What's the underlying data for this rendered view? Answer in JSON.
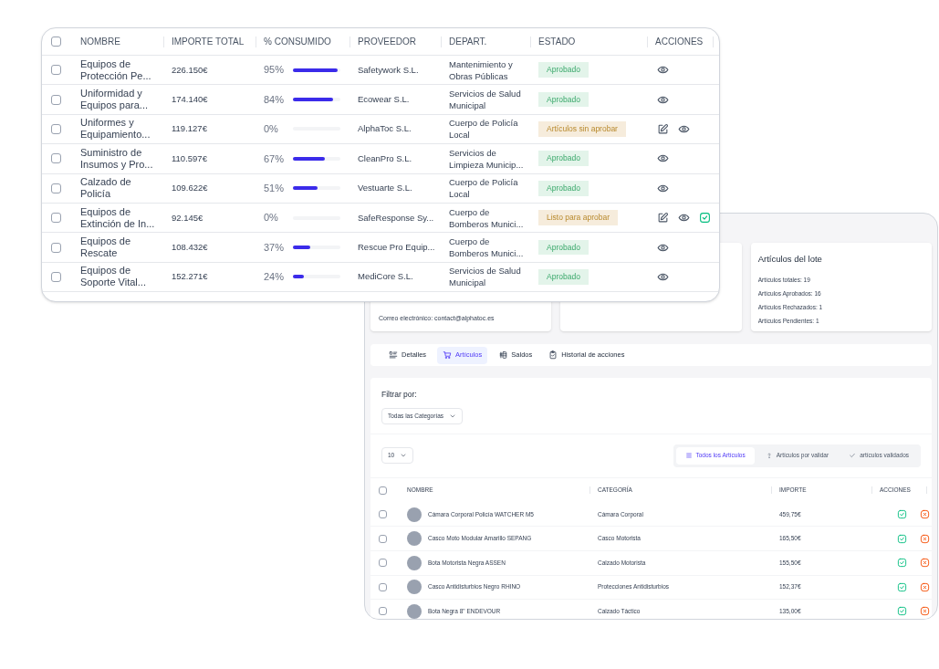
{
  "budget_table": {
    "all_checked": false,
    "columns": [
      "NOMBRE",
      "IMPORTE TOTAL",
      "% CONSUMIDO",
      "PROVEEDOR",
      "DEPART.",
      "ESTADO",
      "ACCIONES"
    ],
    "rows": [
      {
        "checked": false,
        "name": "Equipos de Protección Pe...",
        "amount": "226.150€",
        "consumed": "95%",
        "level": 0.95,
        "supplier": "Safetywork S.L.",
        "department": "Mantenimiento y Obras Públicas",
        "status": {
          "kind": "approved",
          "label": "Aprobado"
        },
        "actions": [
          {
            "kind": "view"
          }
        ]
      },
      {
        "checked": false,
        "name": "Uniformidad y Equipos para...",
        "amount": "174.140€",
        "consumed": "84%",
        "level": 0.84,
        "supplier": "Ecowear S.L.",
        "department": "Servicios de Salud Municipal",
        "status": {
          "kind": "approved",
          "label": "Aprobado"
        },
        "actions": [
          {
            "kind": "view"
          }
        ]
      },
      {
        "checked": false,
        "name": "Uniformes y Equipamiento...",
        "amount": "119.127€",
        "consumed": "0%",
        "level": 0,
        "supplier": "AlphaToc S.L.",
        "department": "Cuerpo de Policía Local",
        "status": {
          "kind": "pending",
          "label": "Artículos sin aprobar"
        },
        "actions": [
          {
            "kind": "edit"
          },
          {
            "kind": "view"
          }
        ]
      },
      {
        "checked": false,
        "name": "Suministro de Insumos y Pro...",
        "amount": "110.597€",
        "consumed": "67%",
        "level": 0.67,
        "supplier": "CleanPro S.L.",
        "department": "Servicios de Limpieza Municip...",
        "status": {
          "kind": "approved",
          "label": "Aprobado"
        },
        "actions": [
          {
            "kind": "view"
          }
        ]
      },
      {
        "checked": false,
        "name": "Calzado de Policía",
        "amount": "109.622€",
        "consumed": "51%",
        "level": 0.51,
        "supplier": "Vestuarte S.L.",
        "department": "Cuerpo de Policía Local",
        "status": {
          "kind": "approved",
          "label": "Aprobado"
        },
        "actions": [
          {
            "kind": "view"
          }
        ]
      },
      {
        "checked": false,
        "name": "Equipos de Extinción de In...",
        "amount": "92.145€",
        "consumed": "0%",
        "level": 0,
        "supplier": "SafeResponse Sy...",
        "department": "Cuerpo de Bomberos Munici...",
        "status": {
          "kind": "pending",
          "label": "Listo para aprobar"
        },
        "actions": [
          {
            "kind": "edit"
          },
          {
            "kind": "view"
          },
          {
            "kind": "approve"
          }
        ]
      },
      {
        "checked": false,
        "name": "Equipos de Rescate",
        "amount": "108.432€",
        "consumed": "37%",
        "level": 0.37,
        "supplier": "Rescue Pro Equip...",
        "department": "Cuerpo de Bomberos Munici...",
        "status": {
          "kind": "approved",
          "label": "Aprobado"
        },
        "actions": [
          {
            "kind": "view"
          }
        ]
      },
      {
        "checked": false,
        "name": "Equipos de Soporte Vital...",
        "amount": "152.271€",
        "consumed": "24%",
        "level": 0.24,
        "supplier": "MediCore S.L.",
        "department": "Servicios de Salud Municipal",
        "status": {
          "kind": "approved",
          "label": "Aprobado"
        },
        "actions": [
          {
            "kind": "view"
          }
        ]
      }
    ]
  },
  "lot_detail": {
    "contact_card": {
      "lines": [
        "Correo electrónico: contact@alphatoc.es"
      ]
    },
    "lot_card": {
      "title": "Artículos del lote",
      "lines": [
        "Artículos totales: 19",
        "Artículos Aprobados: 16",
        "Artículos Rechazados: 1",
        "Artículos Pendientes: 1"
      ]
    },
    "tabs": [
      {
        "label": "Detalles",
        "kind": "details",
        "selected": false
      },
      {
        "label": "Artículos",
        "kind": "cart",
        "selected": true
      },
      {
        "label": "Saldos",
        "kind": "coins",
        "selected": false
      },
      {
        "label": "Historial de acciones",
        "kind": "clipboard",
        "selected": false
      }
    ],
    "filter": {
      "label": "Filtrar por:",
      "category": "Todas las Categorías"
    },
    "page_size": "10",
    "view_filters": [
      {
        "label": "Todos los Artículos",
        "kind": "list",
        "selected": true
      },
      {
        "label": "Artículos por validar",
        "kind": "question",
        "selected": false
      },
      {
        "label": "artículos validados",
        "kind": "check",
        "selected": false
      }
    ],
    "articles": {
      "all_checked": false,
      "columns": [
        "NOMBRE",
        "CATEGORÍA",
        "IMPORTE",
        "ACCIONES"
      ],
      "rows": [
        {
          "checked": false,
          "name": "Cámara Corporal Policía WATCHER M5",
          "category": "Cámara Corporal",
          "amount": "459,75€",
          "actions": [
            {
              "kind": "approve"
            },
            {
              "kind": "reject"
            }
          ]
        },
        {
          "checked": false,
          "name": "Casco Moto Modular Amarillo SEPANG",
          "category": "Casco Motorista",
          "amount": "165,50€",
          "actions": [
            {
              "kind": "approve"
            },
            {
              "kind": "reject"
            }
          ]
        },
        {
          "checked": false,
          "name": "Bota Motorista Negra ASSEN",
          "category": "Calzado Motorista",
          "amount": "155,50€",
          "actions": [
            {
              "kind": "approve"
            },
            {
              "kind": "reject"
            }
          ]
        },
        {
          "checked": false,
          "name": "Casco Antidisturbios Negro RHINO",
          "category": "Protecciones Antidisturbios",
          "amount": "152,37€",
          "actions": [
            {
              "kind": "approve"
            },
            {
              "kind": "reject"
            }
          ]
        },
        {
          "checked": false,
          "name": "Bota Negra 8\" ENDEVOUR",
          "category": "Calzado Táctico",
          "amount": "135,00€",
          "actions": [
            {
              "kind": "approve"
            },
            {
              "kind": "reject"
            }
          ]
        }
      ]
    }
  }
}
